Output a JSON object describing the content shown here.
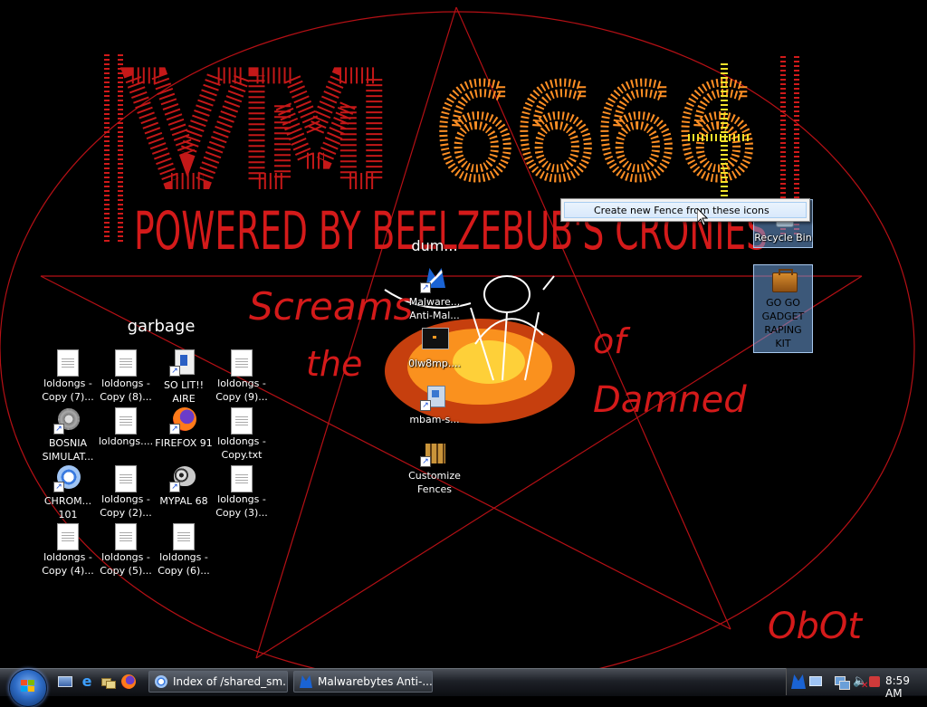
{
  "wallpaper": {
    "title": "VM6666",
    "subtitle": "POWERED BY BEELZEBUB'S CRONIES",
    "words": [
      "Screams",
      "the",
      "of",
      "Damned"
    ],
    "signature": "ObOt",
    "colors": {
      "pentagram": "#c0141a",
      "red_text": "#e01818",
      "orange": "#ff9a22",
      "yellow": "#f2e020"
    }
  },
  "fences": [
    {
      "title": "garbage"
    },
    {
      "title": "dum..."
    }
  ],
  "garbage_icons": [
    {
      "label": "loldongs -\nCopy (7)...",
      "icon": "text-file-icon"
    },
    {
      "label": "loldongs -\nCopy (8)...",
      "icon": "text-file-icon"
    },
    {
      "label": "SO LIT!!\nAIRE",
      "icon": "program-shortcut-icon"
    },
    {
      "label": "loldongs -\nCopy (9)...",
      "icon": "text-file-icon"
    },
    {
      "label": "BOSNIA\nSIMULAT...",
      "icon": "gear-shortcut-icon"
    },
    {
      "label": "loldongs....",
      "icon": "text-file-icon"
    },
    {
      "label": "FIREFOX 91",
      "icon": "firefox-icon"
    },
    {
      "label": "loldongs -\nCopy.txt",
      "icon": "text-file-icon"
    },
    {
      "label": "CHROM...\n101",
      "icon": "chromium-icon"
    },
    {
      "label": "loldongs -\nCopy (2)...",
      "icon": "text-file-icon"
    },
    {
      "label": "MYPAL 68",
      "icon": "mypal-icon"
    },
    {
      "label": "loldongs -\nCopy (3)...",
      "icon": "text-file-icon"
    },
    {
      "label": "loldongs -\nCopy (4)...",
      "icon": "text-file-icon"
    },
    {
      "label": "loldongs -\nCopy (5)...",
      "icon": "text-file-icon"
    },
    {
      "label": "loldongs -\nCopy (6)...",
      "icon": "text-file-icon"
    }
  ],
  "dum_icons": [
    {
      "label": "Malware...\nAnti-Mal...",
      "icon": "malwarebytes-icon"
    },
    {
      "label": "0lw8mp....",
      "icon": "dark-image-icon"
    },
    {
      "label": "mbam-s...",
      "icon": "installer-icon"
    },
    {
      "label": "Customize\nFences",
      "icon": "fences-icon"
    }
  ],
  "desktop_icons": [
    {
      "label": "Recycle Bin",
      "icon": "recycle-bin-icon"
    },
    {
      "label": "GO GO\nGADGET\nRAPING\nKIT",
      "icon": "briefcase-icon"
    }
  ],
  "context_menu": {
    "item": "Create new Fence from these icons"
  },
  "taskbar": {
    "quick_launch": [
      "show-desktop-icon",
      "internet-explorer-icon",
      "switch-windows-icon",
      "firefox-icon"
    ],
    "tasks": [
      {
        "label": "Index of /shared_sm...",
        "icon": "chromium-icon"
      },
      {
        "label": "Malwarebytes Anti-...",
        "icon": "malwarebytes-icon"
      }
    ],
    "clock": "8:59 AM"
  }
}
